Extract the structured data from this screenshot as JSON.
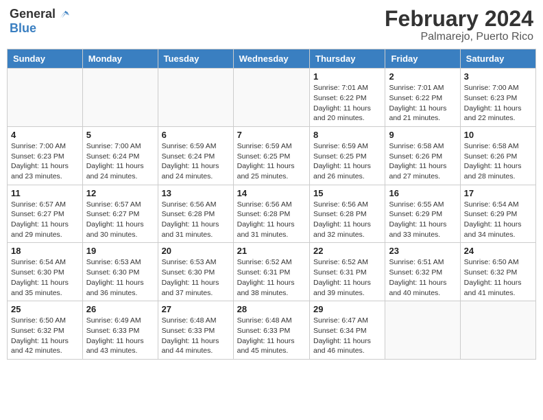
{
  "header": {
    "logo_general": "General",
    "logo_blue": "Blue",
    "title": "February 2024",
    "subtitle": "Palmarejo, Puerto Rico"
  },
  "days_of_week": [
    "Sunday",
    "Monday",
    "Tuesday",
    "Wednesday",
    "Thursday",
    "Friday",
    "Saturday"
  ],
  "weeks": [
    [
      {
        "day": "",
        "info": ""
      },
      {
        "day": "",
        "info": ""
      },
      {
        "day": "",
        "info": ""
      },
      {
        "day": "",
        "info": ""
      },
      {
        "day": "1",
        "info": "Sunrise: 7:01 AM\nSunset: 6:22 PM\nDaylight: 11 hours and 20 minutes."
      },
      {
        "day": "2",
        "info": "Sunrise: 7:01 AM\nSunset: 6:22 PM\nDaylight: 11 hours and 21 minutes."
      },
      {
        "day": "3",
        "info": "Sunrise: 7:00 AM\nSunset: 6:23 PM\nDaylight: 11 hours and 22 minutes."
      }
    ],
    [
      {
        "day": "4",
        "info": "Sunrise: 7:00 AM\nSunset: 6:23 PM\nDaylight: 11 hours and 23 minutes."
      },
      {
        "day": "5",
        "info": "Sunrise: 7:00 AM\nSunset: 6:24 PM\nDaylight: 11 hours and 24 minutes."
      },
      {
        "day": "6",
        "info": "Sunrise: 6:59 AM\nSunset: 6:24 PM\nDaylight: 11 hours and 24 minutes."
      },
      {
        "day": "7",
        "info": "Sunrise: 6:59 AM\nSunset: 6:25 PM\nDaylight: 11 hours and 25 minutes."
      },
      {
        "day": "8",
        "info": "Sunrise: 6:59 AM\nSunset: 6:25 PM\nDaylight: 11 hours and 26 minutes."
      },
      {
        "day": "9",
        "info": "Sunrise: 6:58 AM\nSunset: 6:26 PM\nDaylight: 11 hours and 27 minutes."
      },
      {
        "day": "10",
        "info": "Sunrise: 6:58 AM\nSunset: 6:26 PM\nDaylight: 11 hours and 28 minutes."
      }
    ],
    [
      {
        "day": "11",
        "info": "Sunrise: 6:57 AM\nSunset: 6:27 PM\nDaylight: 11 hours and 29 minutes."
      },
      {
        "day": "12",
        "info": "Sunrise: 6:57 AM\nSunset: 6:27 PM\nDaylight: 11 hours and 30 minutes."
      },
      {
        "day": "13",
        "info": "Sunrise: 6:56 AM\nSunset: 6:28 PM\nDaylight: 11 hours and 31 minutes."
      },
      {
        "day": "14",
        "info": "Sunrise: 6:56 AM\nSunset: 6:28 PM\nDaylight: 11 hours and 31 minutes."
      },
      {
        "day": "15",
        "info": "Sunrise: 6:56 AM\nSunset: 6:28 PM\nDaylight: 11 hours and 32 minutes."
      },
      {
        "day": "16",
        "info": "Sunrise: 6:55 AM\nSunset: 6:29 PM\nDaylight: 11 hours and 33 minutes."
      },
      {
        "day": "17",
        "info": "Sunrise: 6:54 AM\nSunset: 6:29 PM\nDaylight: 11 hours and 34 minutes."
      }
    ],
    [
      {
        "day": "18",
        "info": "Sunrise: 6:54 AM\nSunset: 6:30 PM\nDaylight: 11 hours and 35 minutes."
      },
      {
        "day": "19",
        "info": "Sunrise: 6:53 AM\nSunset: 6:30 PM\nDaylight: 11 hours and 36 minutes."
      },
      {
        "day": "20",
        "info": "Sunrise: 6:53 AM\nSunset: 6:30 PM\nDaylight: 11 hours and 37 minutes."
      },
      {
        "day": "21",
        "info": "Sunrise: 6:52 AM\nSunset: 6:31 PM\nDaylight: 11 hours and 38 minutes."
      },
      {
        "day": "22",
        "info": "Sunrise: 6:52 AM\nSunset: 6:31 PM\nDaylight: 11 hours and 39 minutes."
      },
      {
        "day": "23",
        "info": "Sunrise: 6:51 AM\nSunset: 6:32 PM\nDaylight: 11 hours and 40 minutes."
      },
      {
        "day": "24",
        "info": "Sunrise: 6:50 AM\nSunset: 6:32 PM\nDaylight: 11 hours and 41 minutes."
      }
    ],
    [
      {
        "day": "25",
        "info": "Sunrise: 6:50 AM\nSunset: 6:32 PM\nDaylight: 11 hours and 42 minutes."
      },
      {
        "day": "26",
        "info": "Sunrise: 6:49 AM\nSunset: 6:33 PM\nDaylight: 11 hours and 43 minutes."
      },
      {
        "day": "27",
        "info": "Sunrise: 6:48 AM\nSunset: 6:33 PM\nDaylight: 11 hours and 44 minutes."
      },
      {
        "day": "28",
        "info": "Sunrise: 6:48 AM\nSunset: 6:33 PM\nDaylight: 11 hours and 45 minutes."
      },
      {
        "day": "29",
        "info": "Sunrise: 6:47 AM\nSunset: 6:34 PM\nDaylight: 11 hours and 46 minutes."
      },
      {
        "day": "",
        "info": ""
      },
      {
        "day": "",
        "info": ""
      }
    ]
  ]
}
